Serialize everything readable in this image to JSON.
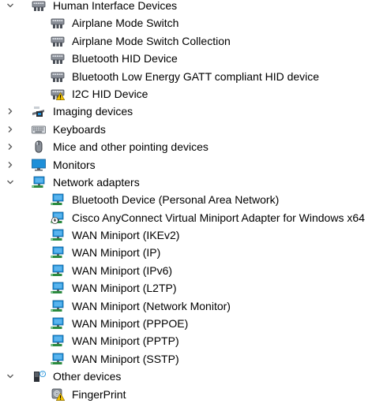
{
  "tree": [
    {
      "label": "Human Interface Devices",
      "level": 0,
      "expanded": true,
      "icon": "hid-icon"
    },
    {
      "label": "Airplane Mode Switch",
      "level": 1,
      "icon": "hid-icon"
    },
    {
      "label": "Airplane Mode Switch Collection",
      "level": 1,
      "icon": "hid-icon"
    },
    {
      "label": "Bluetooth HID Device",
      "level": 1,
      "icon": "hid-icon"
    },
    {
      "label": "Bluetooth Low Energy GATT compliant HID device",
      "level": 1,
      "icon": "hid-icon"
    },
    {
      "label": "I2C HID Device",
      "level": 1,
      "icon": "hid-warning-icon"
    },
    {
      "label": "Imaging devices",
      "level": 0,
      "expanded": false,
      "icon": "camera-icon"
    },
    {
      "label": "Keyboards",
      "level": 0,
      "expanded": false,
      "icon": "keyboard-icon"
    },
    {
      "label": "Mice and other pointing devices",
      "level": 0,
      "expanded": false,
      "icon": "mouse-icon"
    },
    {
      "label": "Monitors",
      "level": 0,
      "expanded": false,
      "icon": "monitor-icon"
    },
    {
      "label": "Network adapters",
      "level": 0,
      "expanded": true,
      "icon": "network-adapter-icon"
    },
    {
      "label": "Bluetooth Device (Personal Area Network)",
      "level": 1,
      "icon": "network-adapter-icon"
    },
    {
      "label": "Cisco AnyConnect Virtual Miniport Adapter for Windows x64",
      "level": 1,
      "icon": "network-adapter-download-icon"
    },
    {
      "label": "WAN Miniport (IKEv2)",
      "level": 1,
      "icon": "network-adapter-icon"
    },
    {
      "label": "WAN Miniport (IP)",
      "level": 1,
      "icon": "network-adapter-icon"
    },
    {
      "label": "WAN Miniport (IPv6)",
      "level": 1,
      "icon": "network-adapter-icon"
    },
    {
      "label": "WAN Miniport (L2TP)",
      "level": 1,
      "icon": "network-adapter-icon"
    },
    {
      "label": "WAN Miniport (Network Monitor)",
      "level": 1,
      "icon": "network-adapter-icon"
    },
    {
      "label": "WAN Miniport (PPPOE)",
      "level": 1,
      "icon": "network-adapter-icon"
    },
    {
      "label": "WAN Miniport (PPTP)",
      "level": 1,
      "icon": "network-adapter-icon"
    },
    {
      "label": "WAN Miniport (SSTP)",
      "level": 1,
      "icon": "network-adapter-icon"
    },
    {
      "label": "Other devices",
      "level": 0,
      "expanded": true,
      "icon": "unknown-device-icon"
    },
    {
      "label": "FingerPrint",
      "level": 1,
      "icon": "unknown-device-warning-icon"
    }
  ],
  "colors": {
    "text": "#000000",
    "chevron": "#555555",
    "monitor_blue": "#1e8fd8",
    "warning_yellow": "#f5c400"
  }
}
